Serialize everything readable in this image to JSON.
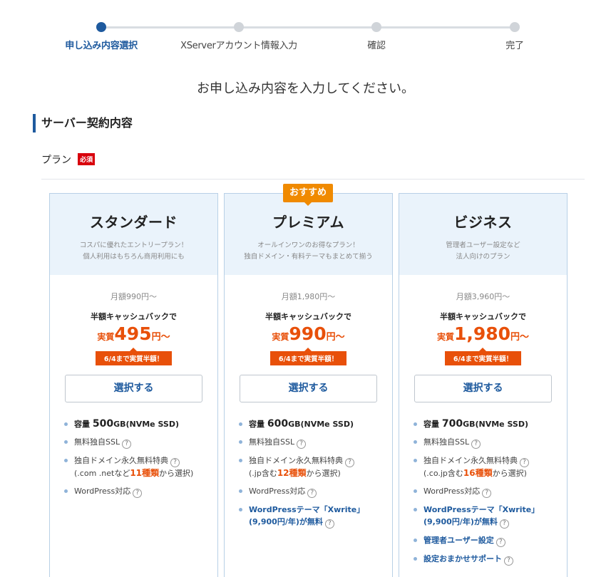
{
  "stepper": {
    "steps": [
      {
        "label": "申し込み内容選択",
        "active": true
      },
      {
        "label": "XServerアカウント情報入力",
        "active": false
      },
      {
        "label": "確認",
        "active": false
      },
      {
        "label": "完了",
        "active": false
      }
    ]
  },
  "lead": "お申し込み内容を入力してください。",
  "section_title": "サーバー契約内容",
  "plan_field": {
    "label": "プラン",
    "required": "必須"
  },
  "recommend_badge": "おすすめ",
  "cards": [
    {
      "name": "スタンダード",
      "desc1": "コスパに優れたエントリープラン！",
      "desc2": "個人利用はもちろん商用利用にも",
      "price_base": "月額990円〜",
      "cashback": "半額キャッシュバックで",
      "actual_prefix": "実質",
      "actual_value": "495",
      "actual_suffix": "円〜",
      "deadline": "6/4まで実質半額！",
      "button": "選択する",
      "features": {
        "storage_label": "容量",
        "storage_value": "500",
        "storage_unit": "GB(NVMe SSD)",
        "ssl": "無料独自SSL",
        "domain": "独自ドメイン永久無料特典",
        "domain_sub_pre": "(.com .netなど",
        "domain_sub_hl": "11種類",
        "domain_sub_post": "から選択)",
        "wordpress": "WordPress対応"
      }
    },
    {
      "name": "プレミアム",
      "desc1": "オールインワンのお得なプラン！",
      "desc2": "独自ドメイン・有料テーマもまとめて揃う",
      "price_base": "月額1,980円〜",
      "cashback": "半額キャッシュバックで",
      "actual_prefix": "実質",
      "actual_value": "990",
      "actual_suffix": "円〜",
      "deadline": "6/4まで実質半額！",
      "button": "選択する",
      "features": {
        "storage_label": "容量",
        "storage_value": "600",
        "storage_unit": "GB(NVMe SSD)",
        "ssl": "無料独自SSL",
        "domain": "独自ドメイン永久無料特典",
        "domain_sub_pre": "(.jp含む",
        "domain_sub_hl": "12種類",
        "domain_sub_post": "から選択)",
        "wordpress": "WordPress対応",
        "theme1": "WordPressテーマ「Xwrite」",
        "theme2": "(9,900円/年)が無料"
      }
    },
    {
      "name": "ビジネス",
      "desc1": "管理者ユーザー設定など",
      "desc2": "法人向けのプラン",
      "price_base": "月額3,960円〜",
      "cashback": "半額キャッシュバックで",
      "actual_prefix": "実質",
      "actual_value": "1,980",
      "actual_suffix": "円〜",
      "deadline": "6/4まで実質半額！",
      "button": "選択する",
      "features": {
        "storage_label": "容量",
        "storage_value": "700",
        "storage_unit": "GB(NVMe SSD)",
        "ssl": "無料独自SSL",
        "domain": "独自ドメイン永久無料特典",
        "domain_sub_pre": "(.co.jp含む",
        "domain_sub_hl": "16種類",
        "domain_sub_post": "から選択)",
        "wordpress": "WordPress対応",
        "theme1": "WordPressテーマ「Xwrite」",
        "theme2": "(9,900円/年)が無料",
        "admin_user": "管理者ユーザー設定",
        "support": "設定おまかせサポート"
      }
    }
  ],
  "colors": {
    "brand": "#1e5a9e",
    "accent": "#e8500a",
    "badge": "#f08a00",
    "required": "#d8000c"
  }
}
